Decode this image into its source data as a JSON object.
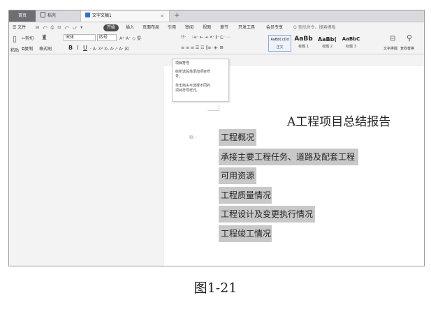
{
  "tabs": {
    "home": "首页",
    "template": "稻壳",
    "doc": "文字文稿1",
    "close": "×",
    "new": "+"
  },
  "menubar": {
    "file": "☰ 文件",
    "qat": [
      "⊟",
      "⤺",
      "⎙",
      "⊡",
      "⤺",
      "⤻",
      "▾"
    ],
    "items": [
      "开始",
      "插入",
      "页面布局",
      "引用",
      "审阅",
      "视图",
      "章节",
      "开发工具",
      "会员专享"
    ],
    "search": "Q 查找命令、搜索模板"
  },
  "ribbon": {
    "paste": "粘贴",
    "cut": "剪切",
    "copy": "复制",
    "format_painter": "格式刷",
    "font_name": "宋体",
    "font_size": "四号",
    "bold": "B",
    "italic": "I",
    "underline": "U",
    "styles": [
      {
        "preview": "AaBbCcDd",
        "caption": "正文"
      },
      {
        "preview": "AaBb",
        "caption": "标题 1"
      },
      {
        "preview": "AaBb(",
        "caption": "标题 2"
      },
      {
        "preview": "AaBbC",
        "caption": "标题 3"
      }
    ],
    "text_layout": "文字排版",
    "find_replace": "查找替换"
  },
  "tooltip": {
    "title": "项目符号",
    "line1": "给所选段落添加项目符",
    "line2": "号。",
    "line3": "单击箭头可选择不同的",
    "line4": "项目符号样式。"
  },
  "document": {
    "title": "A工程项目总结报告",
    "items": [
      "工程概况",
      "承接主要工程任务、道路及配套工程",
      "可用资源",
      "工程质量情况",
      "工程设计及变更执行情况",
      "工程竣工情况"
    ]
  },
  "caption": "图1-21",
  "colors": {
    "accent": "#2b6fd6",
    "highlight": "#c8c8c8",
    "start_button": "#4d4d4d"
  }
}
